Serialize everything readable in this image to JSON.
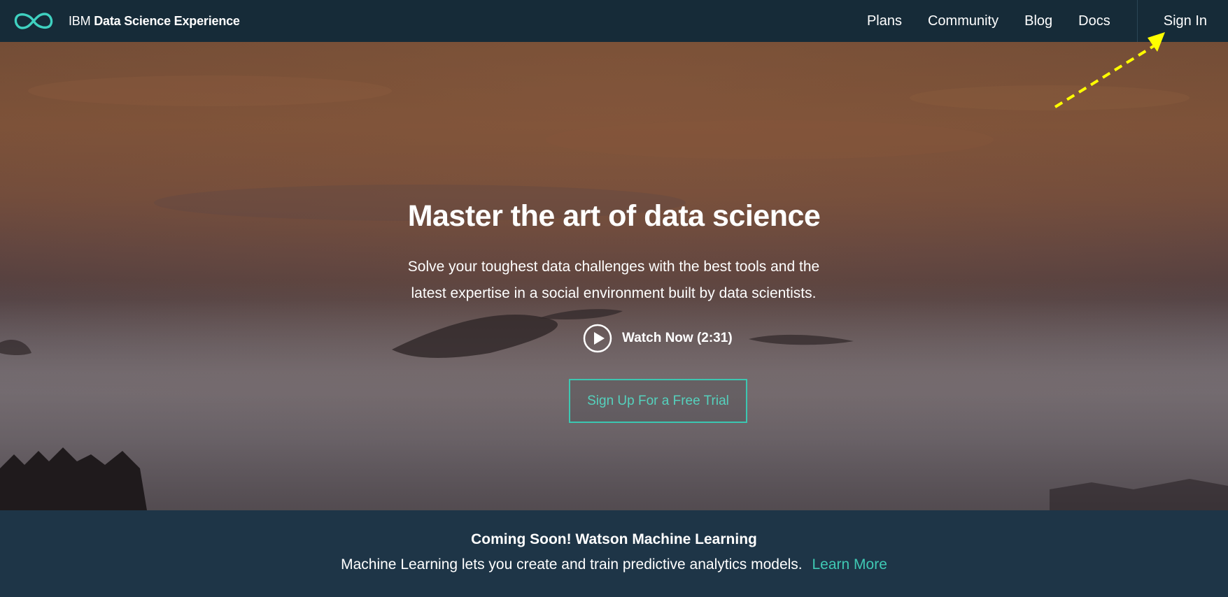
{
  "header": {
    "brand_prefix": "IBM",
    "brand_name": "Data Science Experience",
    "nav": {
      "plans": "Plans",
      "community": "Community",
      "blog": "Blog",
      "docs": "Docs",
      "sign_in": "Sign In"
    }
  },
  "hero": {
    "headline": "Master the art of data science",
    "subhead": "Solve your toughest data challenges with the best tools and the latest expertise in a social environment built by data scientists.",
    "watch_label": "Watch Now (2:31)",
    "cta_label": "Sign Up For a Free Trial"
  },
  "banner": {
    "title": "Coming Soon! Watson Machine Learning",
    "text": "Machine Learning lets you create and train predictive analytics models.",
    "link": "Learn More"
  },
  "colors": {
    "header_bg": "#162b38",
    "banner_bg": "#1e3547",
    "accent": "#3fc9b4",
    "annotation_arrow": "#ffff00"
  },
  "icons": {
    "logo": "infinity-logo-icon",
    "play": "play-circle-icon",
    "annotation": "dashed-arrow-annotation"
  }
}
